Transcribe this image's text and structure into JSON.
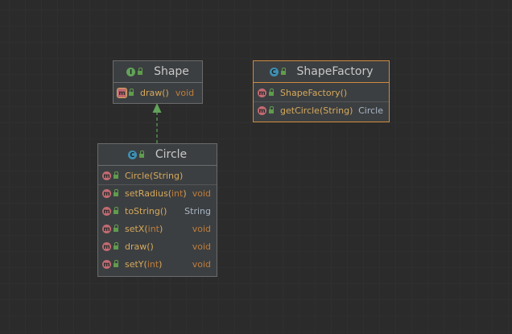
{
  "diagram": {
    "shape": {
      "title": "Shape",
      "kind_badge": "I",
      "methods": [
        {
          "name": "draw",
          "params": "",
          "return": "void"
        }
      ]
    },
    "shape_factory": {
      "title": "ShapeFactory",
      "kind_badge": "C",
      "methods": [
        {
          "name": "ShapeFactory",
          "params": "",
          "return": ""
        },
        {
          "name": "getCircle",
          "params": "String",
          "return": "Circle"
        }
      ]
    },
    "circle": {
      "title": "Circle",
      "kind_badge": "C",
      "methods": [
        {
          "name": "Circle",
          "params": "String",
          "return": ""
        },
        {
          "name": "setRadius",
          "params": "int",
          "return": "void"
        },
        {
          "name": "toString",
          "params": "",
          "return": "String"
        },
        {
          "name": "setX",
          "params": "int",
          "return": "void"
        },
        {
          "name": "draw",
          "params": "",
          "return": "void"
        },
        {
          "name": "setY",
          "params": "int",
          "return": "void"
        }
      ]
    },
    "method_badge": "m",
    "colors": {
      "background": "#2b2b2b",
      "node_fill": "#3c3f41",
      "selected_border": "#d08b3e",
      "implements_arrow": "#62a35a",
      "method_name": "#d6a95c",
      "param_type": "#c07d3b"
    }
  }
}
